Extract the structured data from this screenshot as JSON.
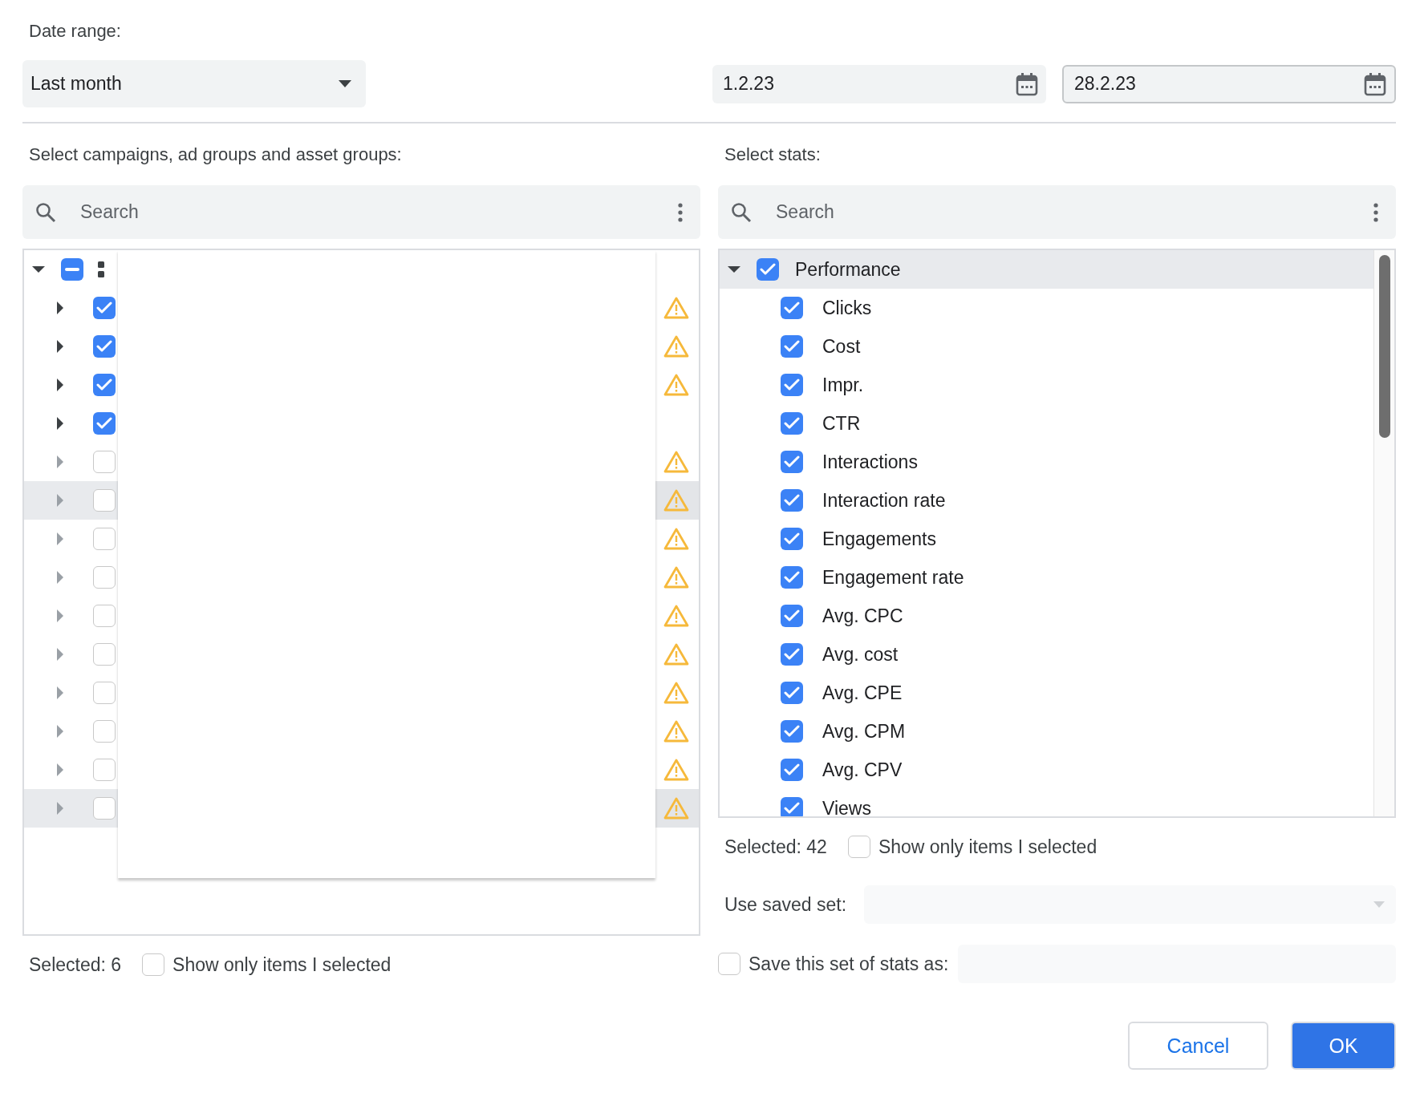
{
  "date_range": {
    "label": "Date range:",
    "preset": "Last month",
    "start": "1.2.23",
    "end": "28.2.23"
  },
  "campaigns": {
    "label": "Select campaigns, ad groups and asset groups:",
    "search_placeholder": "Search",
    "tree": {
      "expanded": true,
      "indeterminate": true,
      "children": [
        {
          "checked": true,
          "warning": true,
          "highlighted": false
        },
        {
          "checked": true,
          "warning": true,
          "highlighted": false
        },
        {
          "checked": true,
          "warning": true,
          "highlighted": false
        },
        {
          "checked": true,
          "warning": false,
          "highlighted": false
        },
        {
          "checked": false,
          "warning": true,
          "highlighted": false
        },
        {
          "checked": false,
          "warning": true,
          "highlighted": true
        },
        {
          "checked": false,
          "warning": true,
          "highlighted": false
        },
        {
          "checked": false,
          "warning": true,
          "highlighted": false
        },
        {
          "checked": false,
          "warning": true,
          "highlighted": false
        },
        {
          "checked": false,
          "warning": true,
          "highlighted": false
        },
        {
          "checked": false,
          "warning": true,
          "highlighted": false
        },
        {
          "checked": false,
          "warning": true,
          "highlighted": false
        },
        {
          "checked": false,
          "warning": true,
          "highlighted": false
        },
        {
          "checked": false,
          "warning": true,
          "highlighted": true
        }
      ]
    },
    "selected_count": "Selected: 6",
    "show_only_selected": {
      "label": "Show only items I selected",
      "checked": false
    }
  },
  "stats": {
    "label": "Select stats:",
    "search_placeholder": "Search",
    "groups": [
      {
        "label": "Performance",
        "expanded": true,
        "checked": true,
        "children": [
          {
            "label": "Clicks",
            "checked": true
          },
          {
            "label": "Cost",
            "checked": true
          },
          {
            "label": "Impr.",
            "checked": true
          },
          {
            "label": "CTR",
            "checked": true
          },
          {
            "label": "Interactions",
            "checked": true
          },
          {
            "label": "Interaction rate",
            "checked": true
          },
          {
            "label": "Engagements",
            "checked": true
          },
          {
            "label": "Engagement rate",
            "checked": true
          },
          {
            "label": "Avg. CPC",
            "checked": true
          },
          {
            "label": "Avg. cost",
            "checked": true
          },
          {
            "label": "Avg. CPE",
            "checked": true
          },
          {
            "label": "Avg. CPM",
            "checked": true
          },
          {
            "label": "Avg. CPV",
            "checked": true
          },
          {
            "label": "Views",
            "checked": true
          }
        ]
      }
    ],
    "selected_count": "Selected: 42",
    "show_only_selected": {
      "label": "Show only items I selected",
      "checked": false
    },
    "saved_set_label": "Use saved set:",
    "save_set": {
      "label": "Save this set of stats as:",
      "checked": false
    }
  },
  "buttons": [
    {
      "label": "Cancel",
      "kind": "secondary"
    },
    {
      "label": "OK",
      "kind": "primary"
    }
  ]
}
